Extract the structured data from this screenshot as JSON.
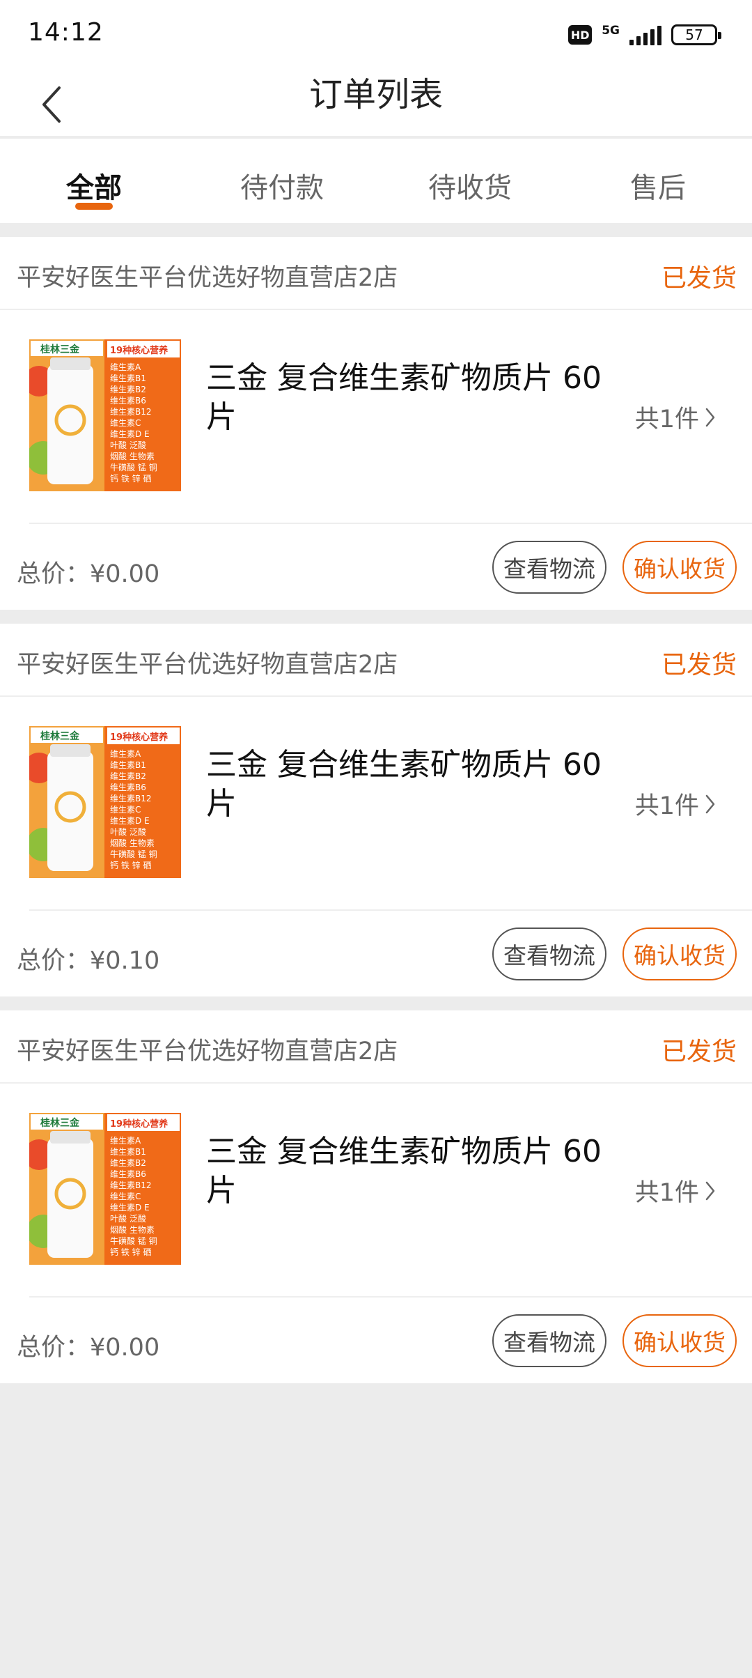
{
  "status_bar": {
    "time": "14:12",
    "hd": "HD",
    "network": "5G",
    "battery": "57"
  },
  "nav": {
    "title": "订单列表",
    "back_icon": "chevron-left-icon"
  },
  "tabs": [
    {
      "label": "全部",
      "active": true
    },
    {
      "label": "待付款",
      "active": false
    },
    {
      "label": "待收货",
      "active": false
    },
    {
      "label": "售后",
      "active": false
    }
  ],
  "orders": [
    {
      "store": "平安好医生平台优选好物直营店2店",
      "status": "已发货",
      "product": {
        "name": "三金 复合维生素矿物质片 60片",
        "count": "共1件",
        "thumb_brand": "桂林三金",
        "thumb_badge": "19种核心营养",
        "thumb_lines": [
          "维生素A",
          "维生素B1",
          "维生素B2",
          "维生素B6",
          "维生素B12",
          "维生素C",
          "维生素D E",
          "叶酸 泛酸",
          "烟酸 生物素",
          "牛磺酸 锰 铜",
          "钙 铁 锌 硒"
        ]
      },
      "total_label": "总价：",
      "total": "¥0.00",
      "btn_logistics": "查看物流",
      "btn_confirm": "确认收货"
    },
    {
      "store": "平安好医生平台优选好物直营店2店",
      "status": "已发货",
      "product": {
        "name": "三金 复合维生素矿物质片 60片",
        "count": "共1件",
        "thumb_brand": "桂林三金",
        "thumb_badge": "19种核心营养",
        "thumb_lines": [
          "维生素A",
          "维生素B1",
          "维生素B2",
          "维生素B6",
          "维生素B12",
          "维生素C",
          "维生素D E",
          "叶酸 泛酸",
          "烟酸 生物素",
          "牛磺酸 锰 铜",
          "钙 铁 锌 硒"
        ]
      },
      "total_label": "总价：",
      "total": "¥0.10",
      "btn_logistics": "查看物流",
      "btn_confirm": "确认收货"
    },
    {
      "store": "平安好医生平台优选好物直营店2店",
      "status": "已发货",
      "product": {
        "name": "三金 复合维生素矿物质片 60片",
        "count": "共1件",
        "thumb_brand": "桂林三金",
        "thumb_badge": "19种核心营养",
        "thumb_lines": [
          "维生素A",
          "维生素B1",
          "维生素B2",
          "维生素B6",
          "维生素B12",
          "维生素C",
          "维生素D E",
          "叶酸 泛酸",
          "烟酸 生物素",
          "牛磺酸 锰 铜",
          "钙 铁 锌 硒"
        ]
      },
      "total_label": "总价：",
      "total": "¥0.00",
      "btn_logistics": "查看物流",
      "btn_confirm": "确认收货"
    }
  ],
  "colors": {
    "accent": "#e8650e",
    "background": "#ececec"
  }
}
